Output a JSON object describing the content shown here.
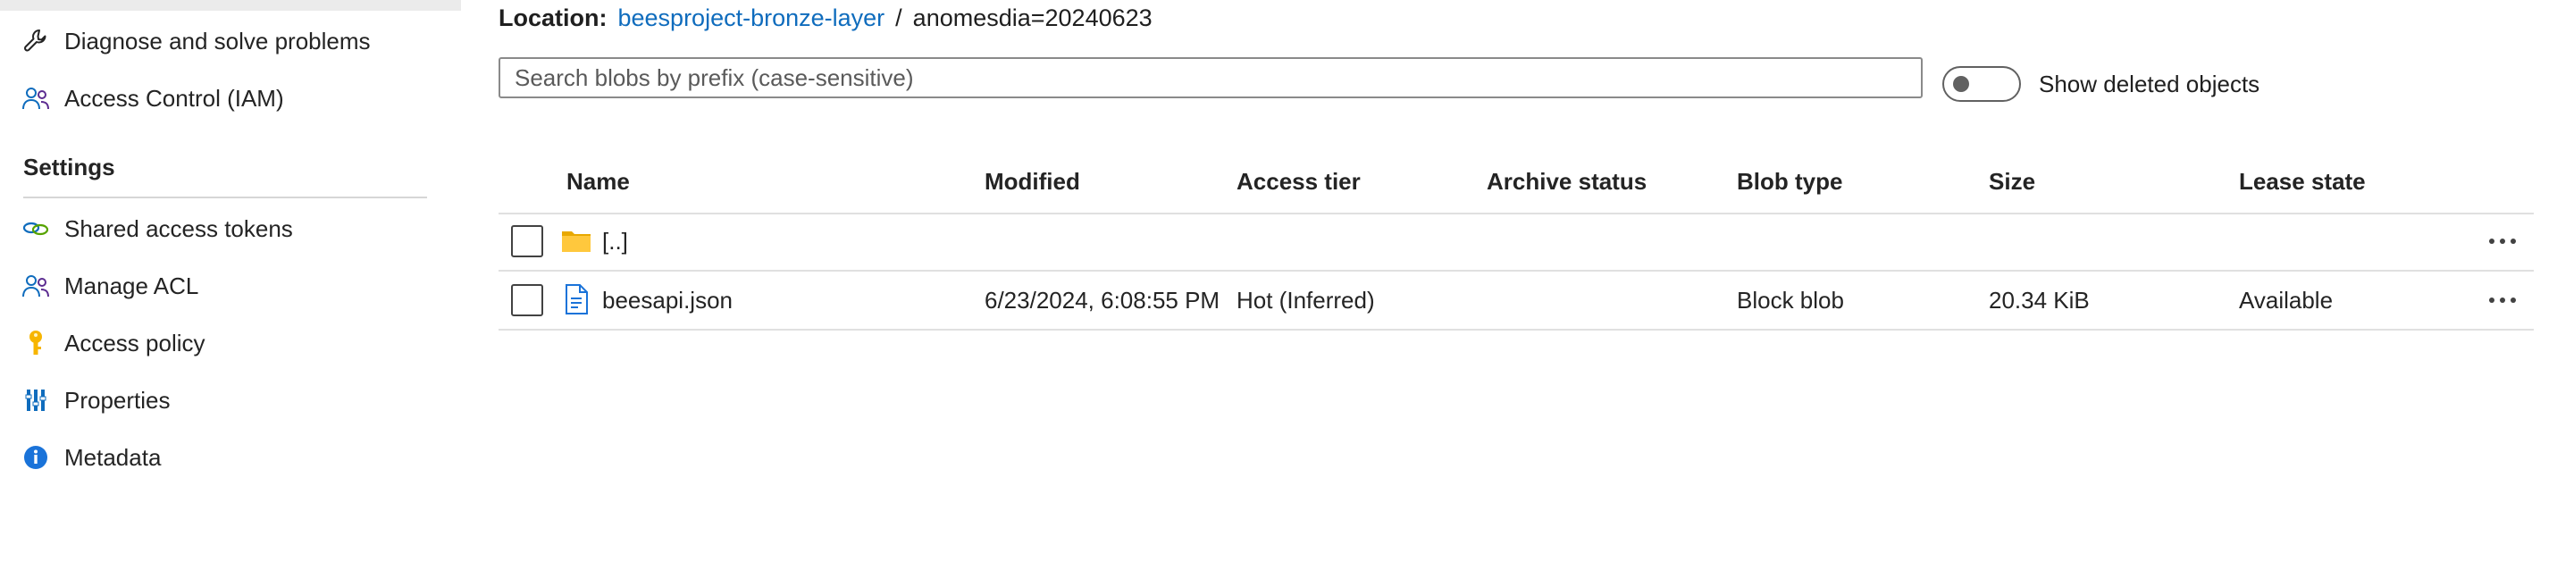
{
  "sidebar": {
    "items_top": [
      {
        "label": "Diagnose and solve problems",
        "icon": "wrench-icon"
      },
      {
        "label": "Access Control (IAM)",
        "icon": "people-icon"
      }
    ],
    "section_title": "Settings",
    "items_settings": [
      {
        "label": "Shared access tokens",
        "icon": "link-icon"
      },
      {
        "label": "Manage ACL",
        "icon": "people-icon"
      },
      {
        "label": "Access policy",
        "icon": "key-icon"
      },
      {
        "label": "Properties",
        "icon": "properties-icon"
      },
      {
        "label": "Metadata",
        "icon": "info-icon"
      }
    ]
  },
  "location": {
    "label": "Location:",
    "container": "beesproject-bronze-layer",
    "separator": "/",
    "path": "anomesdia=20240623"
  },
  "search": {
    "placeholder": "Search blobs by prefix (case-sensitive)",
    "value": ""
  },
  "toggle": {
    "label": "Show deleted objects",
    "checked": false
  },
  "table": {
    "columns": [
      "Name",
      "Modified",
      "Access tier",
      "Archive status",
      "Blob type",
      "Size",
      "Lease state"
    ],
    "rows": [
      {
        "icon": "folder-icon",
        "name": "[..]",
        "modified": "",
        "access_tier": "",
        "archive_status": "",
        "blob_type": "",
        "size": "",
        "lease_state": ""
      },
      {
        "icon": "file-icon",
        "name": "beesapi.json",
        "modified": "6/23/2024, 6:08:55 PM",
        "access_tier": "Hot (Inferred)",
        "archive_status": "",
        "blob_type": "Block blob",
        "size": "20.34 KiB",
        "lease_state": "Available"
      }
    ]
  },
  "colors": {
    "link": "#0f6cbd",
    "folder": "#f2b800",
    "accent_blue": "#0f6cbd",
    "key": "#f7b500"
  }
}
